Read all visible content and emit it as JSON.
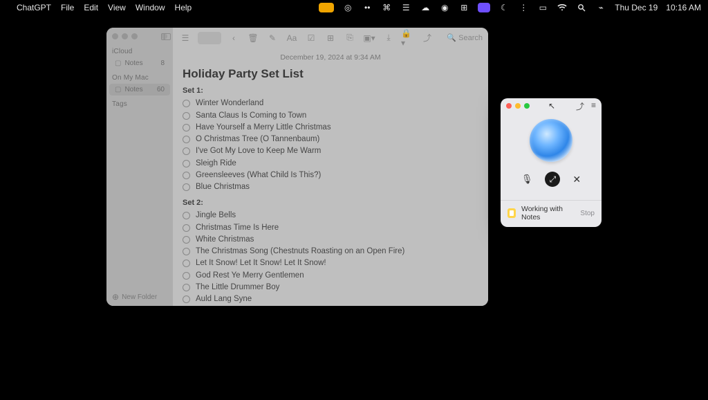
{
  "menubar": {
    "app": "ChatGPT",
    "items": [
      "File",
      "Edit",
      "View",
      "Window",
      "Help"
    ],
    "right": {
      "day": "Thu Dec 19",
      "time": "10:16 AM"
    }
  },
  "notes": {
    "sidebar": {
      "section1": "iCloud",
      "item1_label": "Notes",
      "item1_count": "8",
      "section2": "On My Mac",
      "item2_label": "Notes",
      "item2_count": "60",
      "section3": "Tags",
      "footer": "New Folder"
    },
    "toolbar": {
      "search_placeholder": "Search"
    },
    "date": "December 19, 2024 at 9:34 AM",
    "title": "Holiday Party Set List",
    "set1_label": "Set 1:",
    "set1": [
      "Winter Wonderland",
      "Santa Claus Is Coming to Town",
      "Have Yourself a Merry Little Christmas",
      "O Christmas Tree (O Tannenbaum)",
      "I've Got My Love to Keep Me Warm",
      "Sleigh Ride",
      "Greensleeves (What Child Is This?)",
      "Blue Christmas"
    ],
    "set2_label": "Set 2:",
    "set2": [
      "Jingle Bells",
      "Christmas Time Is Here",
      "White Christmas",
      "The Christmas Song (Chestnuts Roasting on an Open Fire)",
      "Let It Snow! Let It Snow! Let It Snow!",
      "God Rest Ye Merry Gentlemen",
      "The Little Drummer Boy",
      "Auld Lang Syne"
    ]
  },
  "assistant": {
    "status_text": "Working with Notes",
    "stop_label": "Stop"
  }
}
